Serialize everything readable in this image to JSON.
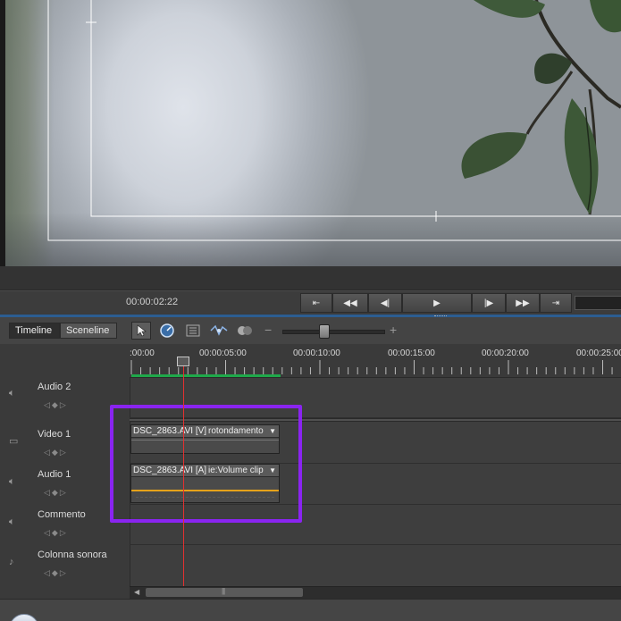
{
  "transport": {
    "timecode": "00:00:02:22",
    "buttons": [
      {
        "name": "goto-in-button",
        "glyph": "⇤"
      },
      {
        "name": "rewind-button",
        "glyph": "◀◀"
      },
      {
        "name": "step-back-button",
        "glyph": "◀|"
      },
      {
        "name": "play-button",
        "glyph": "▶"
      },
      {
        "name": "step-forward-button",
        "glyph": "|▶"
      },
      {
        "name": "fast-forward-button",
        "glyph": "▶▶"
      },
      {
        "name": "goto-out-button",
        "glyph": "⇥"
      }
    ]
  },
  "panel": {
    "tabs": {
      "timeline": "Timeline",
      "sceneline": "Sceneline"
    },
    "tools": [
      "selection-tool-icon",
      "time-stretch-icon",
      "properties-icon",
      "smart-mix-icon",
      "toggle-icon"
    ],
    "zoom_minus": "−",
    "zoom_plus": "+",
    "zoom_level": 0.38
  },
  "ruler": {
    "labels": [
      ":00:00",
      "00:00:05:00",
      "00:00:10:00",
      "00:00:15:00",
      "00:00:20:00",
      "00:00:25:00"
    ]
  },
  "tracks": [
    {
      "name": "Audio 2",
      "icon": "speaker-icon"
    },
    {
      "name": "Video 1",
      "icon": "film-icon"
    },
    {
      "name": "Audio 1",
      "icon": "speaker-icon"
    },
    {
      "name": "Commento",
      "icon": "speaker-icon"
    },
    {
      "name": "Colonna sonora",
      "icon": "note-icon"
    }
  ],
  "clips": {
    "video": {
      "title": "DSC_2863.AVI [V]",
      "effect": "rotondamento"
    },
    "audio": {
      "title": "DSC_2863.AVI [A]",
      "effect": "ie:Volume clip"
    }
  },
  "colors": {
    "highlight": "#8a24f0",
    "playhead": "#e23030",
    "volume_line": "#e6a21a",
    "work_area": "#1fa84a",
    "accent_bar": "#2c5d91"
  }
}
